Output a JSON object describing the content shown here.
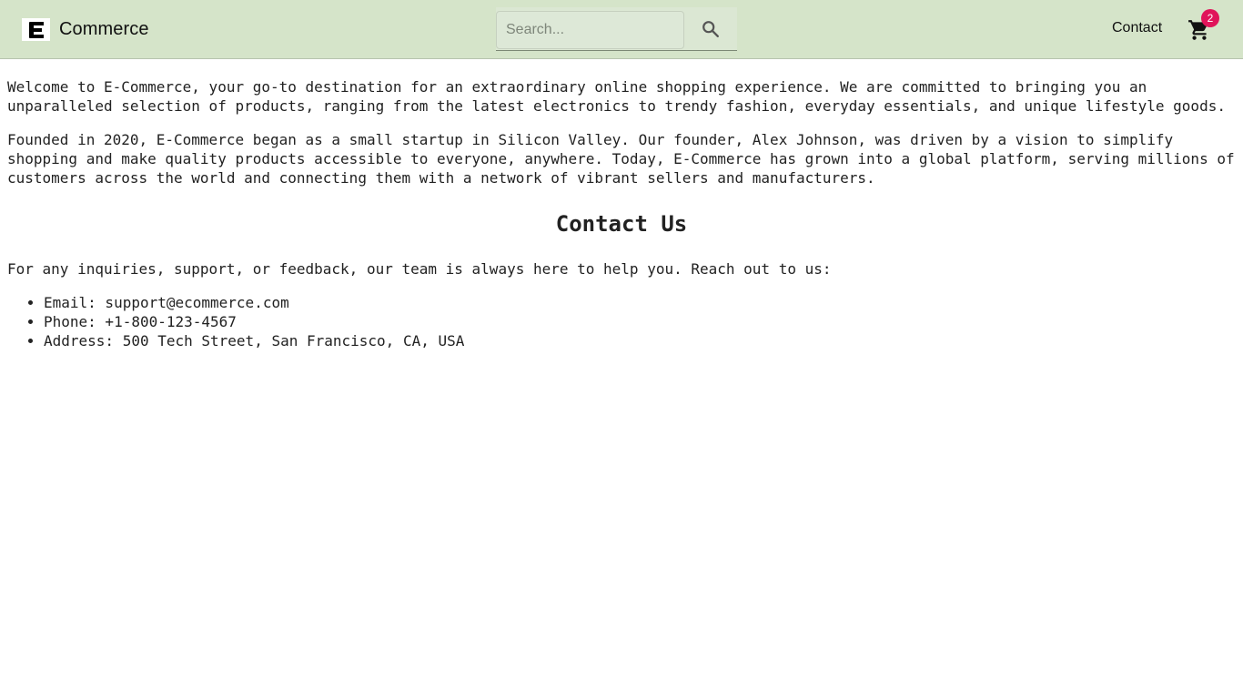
{
  "header": {
    "brand_name": "Commerce",
    "logo_letter": "E",
    "search": {
      "placeholder": "Search...",
      "value": ""
    },
    "contact_label": "Contact",
    "cart_count": "2"
  },
  "main": {
    "intro": "Welcome to E-Commerce, your go-to destination for an extraordinary online shopping experience. We are committed to bringing you an unparalleled selection of products, ranging from the latest electronics to trendy fashion, everyday essentials, and unique lifestyle goods.",
    "history": "Founded in 2020, E-Commerce began as a small startup in Silicon Valley. Our founder, Alex Johnson, was driven by a vision to simplify shopping and make quality products accessible to everyone, anywhere. Today, E-Commerce has grown into a global platform, serving millions of customers across the world and connecting them with a network of vibrant sellers and manufacturers.",
    "contact_heading": "Contact Us",
    "contact_text": "For any inquiries, support, or feedback, our team is always here to help you. Reach out to us:",
    "contact_items": [
      "Email: support@ecommerce.com",
      "Phone: +1-800-123-4567",
      "Address: 500 Tech Street, San Francisco, CA, USA"
    ]
  },
  "icons": {
    "logo": "e-logo-icon",
    "search": "search-icon",
    "cart": "shopping-cart-icon"
  },
  "colors": {
    "header_bg": "#d5e4c9",
    "badge_bg": "#e0145a"
  }
}
